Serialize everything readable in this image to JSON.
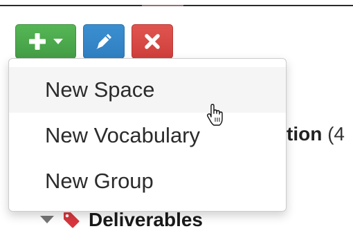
{
  "toolbar": {
    "add_icon": "plus-icon",
    "add_caret_icon": "caret-down-icon",
    "edit_icon": "pencil-icon",
    "delete_icon": "times-icon",
    "colors": {
      "add": "#449d44",
      "edit": "#2f7fc1",
      "delete": "#cf3f3b"
    }
  },
  "dropdown": {
    "items": [
      {
        "label": "New Space"
      },
      {
        "label": "New Vocabulary"
      },
      {
        "label": "New Group"
      }
    ],
    "hovered_index": 0
  },
  "background": {
    "heading_bold": "tion",
    "heading_count": "(4",
    "tree_item_label": "Deliverables",
    "tree_item_icon": "tag-icon",
    "tree_caret_icon": "caret-down-icon",
    "tag_color": "#d9363e"
  },
  "cursor": {
    "icon": "hand-pointer-icon"
  }
}
